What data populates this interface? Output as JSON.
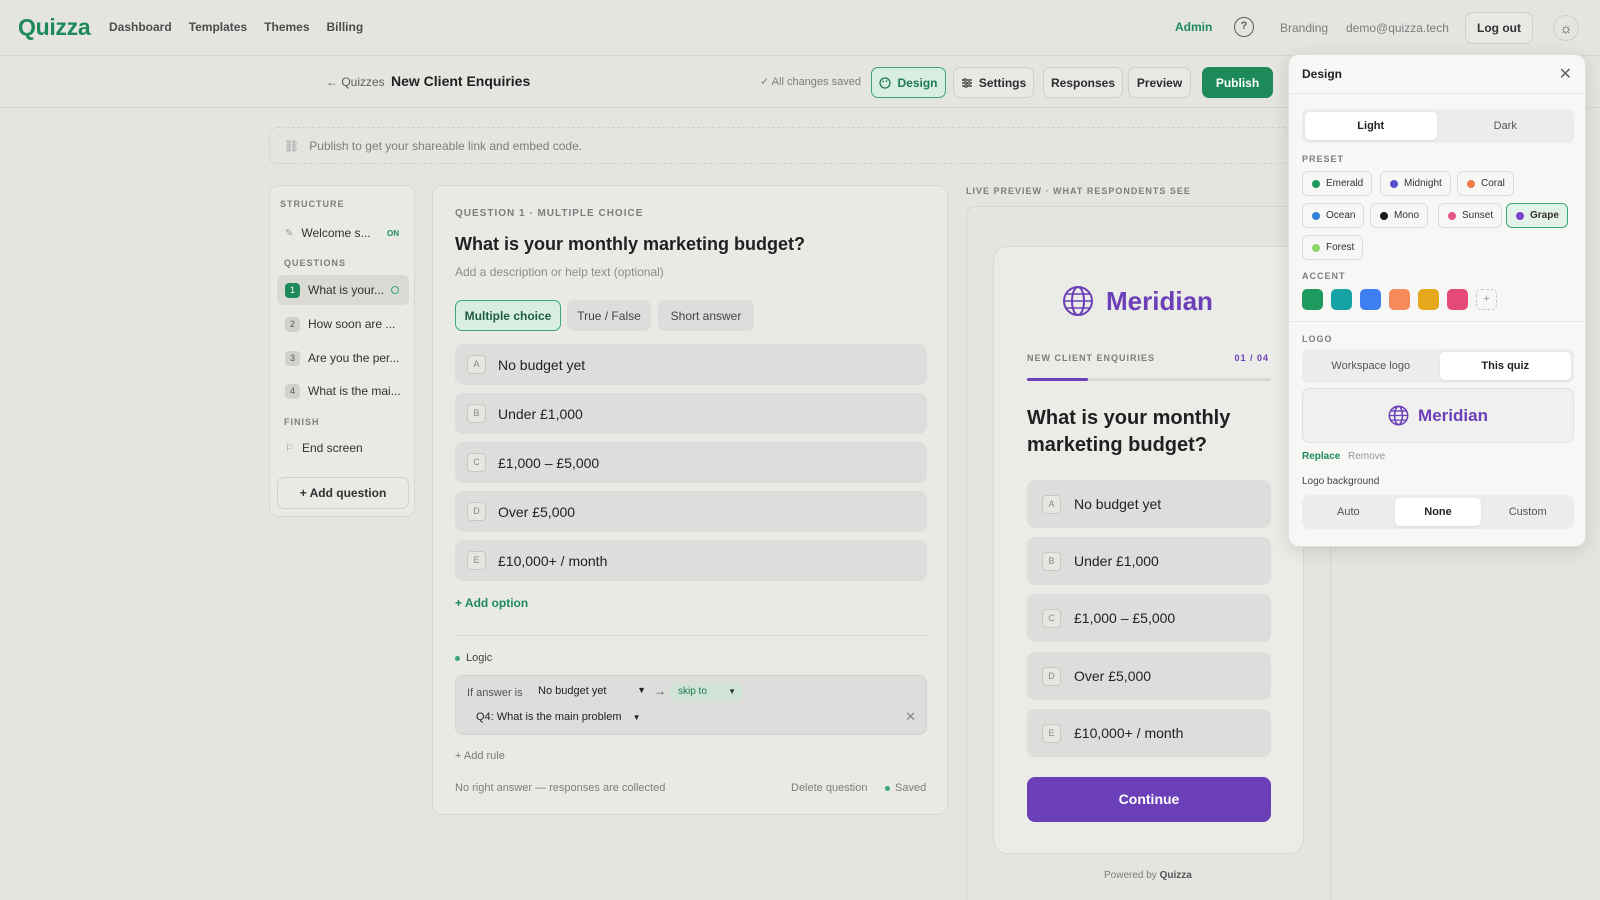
{
  "app": {
    "logo": "Quizza"
  },
  "nav": {
    "links": [
      "Dashboard",
      "Templates",
      "Themes",
      "Billing"
    ],
    "admin": "Admin",
    "help": "?",
    "branding": "Branding",
    "email": "demo@quizza.tech",
    "logout": "Log out"
  },
  "subbar": {
    "back": "← Quizzes",
    "title": "New Client Enquiries",
    "saved": "✓ All changes saved",
    "design": "Design",
    "settings": "Settings",
    "responses": "Responses",
    "preview": "Preview",
    "publish": "Publish"
  },
  "banner": {
    "text": "Publish to get your shareable link and embed code."
  },
  "structure": {
    "label": "STRUCTURE",
    "welcome": "Welcome s...",
    "welcome_badge": "ON",
    "questions_label": "QUESTIONS",
    "questions": [
      {
        "num": "1",
        "label": "What is your..."
      },
      {
        "num": "2",
        "label": "How soon are ..."
      },
      {
        "num": "3",
        "label": "Are you the per..."
      },
      {
        "num": "4",
        "label": "What is the mai..."
      }
    ],
    "finish_label": "FINISH",
    "end_screen": "End screen",
    "add_question": "+ Add question"
  },
  "editor": {
    "meta": "QUESTION 1 · MULTIPLE CHOICE",
    "title": "What is your monthly marketing budget?",
    "description_placeholder": "Add a description or help text (optional)",
    "types": [
      "Multiple choice",
      "True / False",
      "Short answer"
    ],
    "options": [
      {
        "key": "A",
        "label": "No budget yet"
      },
      {
        "key": "B",
        "label": "Under £1,000"
      },
      {
        "key": "C",
        "label": "£1,000 – £5,000"
      },
      {
        "key": "D",
        "label": "Over £5,000"
      },
      {
        "key": "E",
        "label": "£10,000+ / month"
      }
    ],
    "add_option": "+ Add option",
    "logic_label": "Logic",
    "logic_if": "If answer is",
    "logic_answer": "No budget yet",
    "logic_action": "skip to",
    "logic_target": "Q4: What is the main problem",
    "add_rule": "+ Add rule",
    "no_right_answer": "No right answer — responses are collected",
    "delete": "Delete question",
    "saved": "Saved"
  },
  "preview": {
    "label": "LIVE PREVIEW · WHAT RESPONDENTS SEE",
    "brand": "Meridian",
    "quiz_name": "NEW CLIENT ENQUIRIES",
    "counter": "01 / 04",
    "progress": 0.25,
    "question": "What is your monthly marketing budget?",
    "continue": "Continue",
    "powered_prefix": "Powered by",
    "powered_brand": "Quizza"
  },
  "design": {
    "title": "Design",
    "modes": [
      "Light",
      "Dark"
    ],
    "mode_selected": "Light",
    "preset_label": "PRESET",
    "presets": [
      {
        "name": "Emerald",
        "color": "#1e9a5e"
      },
      {
        "name": "Midnight",
        "color": "#5b4fd1"
      },
      {
        "name": "Coral",
        "color": "#f07a4a"
      },
      {
        "name": "Ocean",
        "color": "#2f7fd8"
      },
      {
        "name": "Mono",
        "color": "#1a1a1a"
      },
      {
        "name": "Sunset",
        "color": "#e8578a"
      },
      {
        "name": "Grape",
        "color": "#7a44c8"
      },
      {
        "name": "Forest",
        "color": "#8fd46a"
      }
    ],
    "preset_selected": "Grape",
    "accent_label": "ACCENT",
    "accents": [
      "#1e9a5e",
      "#17a3a3",
      "#3f7ef0",
      "#f78a5a",
      "#e5a71b",
      "#e64a78"
    ],
    "logo_label": "LOGO",
    "logo_sources": [
      "Workspace logo",
      "This quiz"
    ],
    "logo_source_selected": "This quiz",
    "logo_brand": "Meridian",
    "replace": "Replace",
    "remove": "Remove",
    "logo_bg_label": "Logo background",
    "logo_bg_options": [
      "Auto",
      "None",
      "Custom"
    ],
    "logo_bg_selected": "None"
  },
  "colors": {
    "brand_green": "#1e8a5a",
    "preview_purple": "#6b3fb8"
  }
}
